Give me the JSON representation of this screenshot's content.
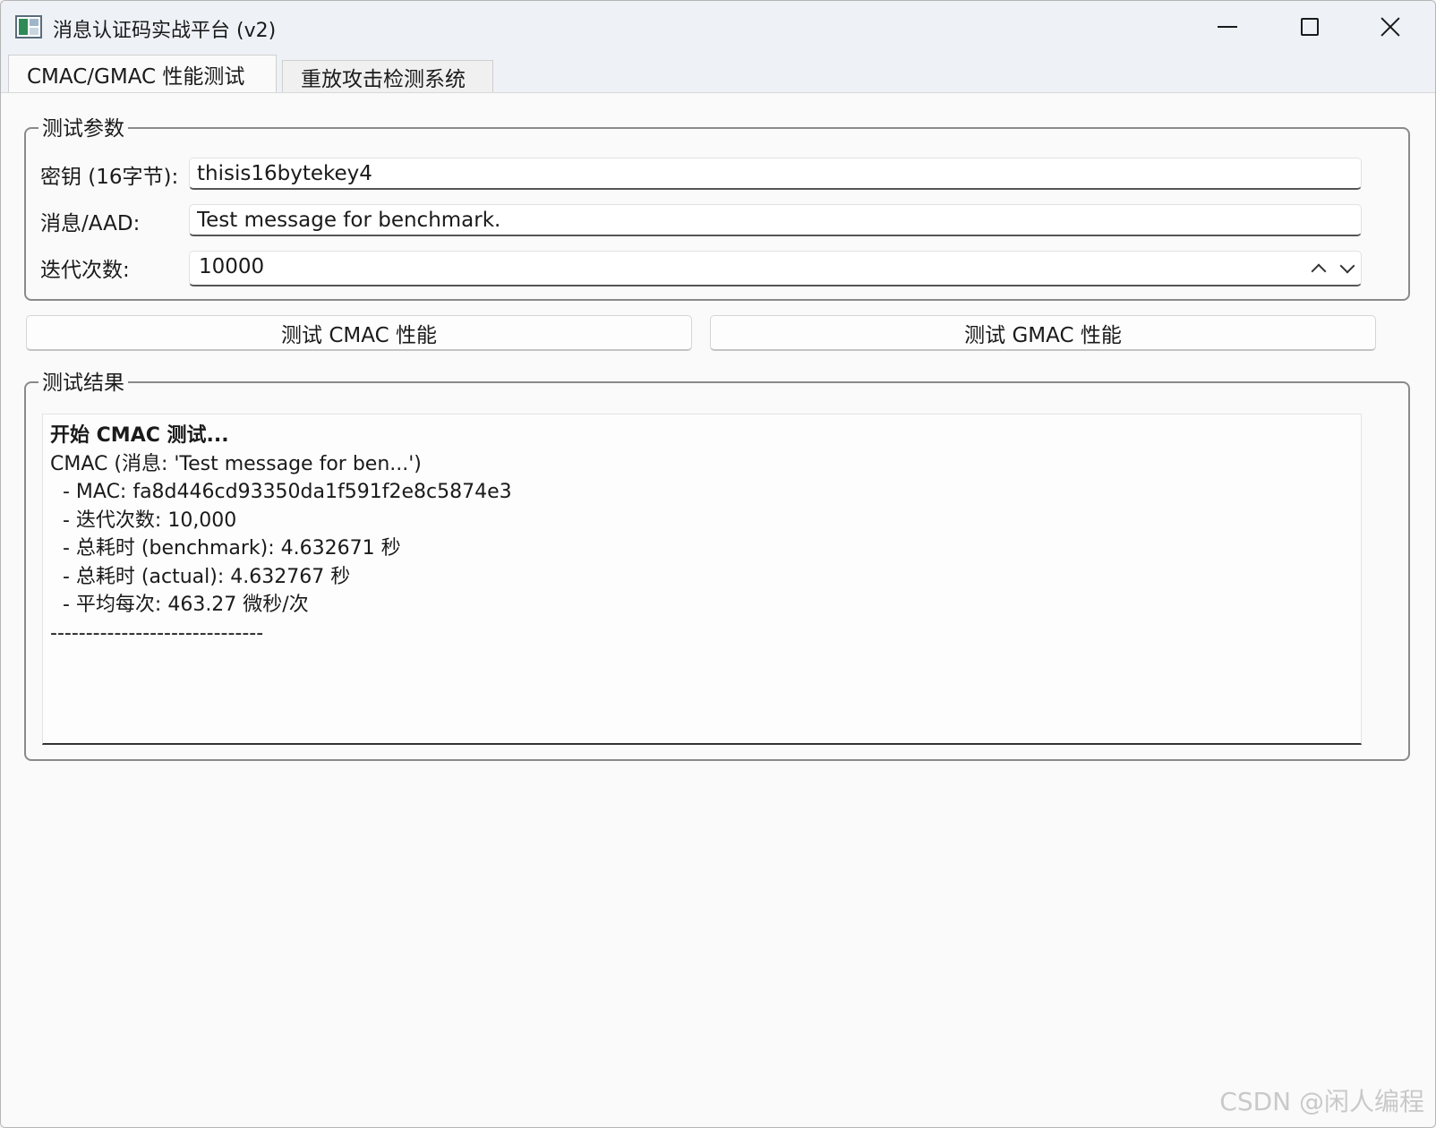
{
  "window": {
    "title": "消息认证码实战平台 (v2)"
  },
  "tabs": [
    {
      "label": "CMAC/GMAC 性能测试",
      "active": true
    },
    {
      "label": "重放攻击检测系统",
      "active": false
    }
  ],
  "params": {
    "title": "测试参数",
    "key_label": "密钥 (16字节):",
    "key_value": "thisis16bytekey4",
    "message_label": "消息/AAD:",
    "message_value": "Test message for benchmark.",
    "iterations_label": "迭代次数:",
    "iterations_value": "10000"
  },
  "actions": {
    "cmac_label": "测试 CMAC 性能",
    "gmac_label": "测试 GMAC 性能"
  },
  "results": {
    "title": "测试结果",
    "lines": [
      "开始 CMAC 测试...",
      "CMAC (消息: 'Test message for ben...')",
      "  - MAC: fa8d446cd93350da1f591f2e8c5874e3",
      "  - 迭代次数: 10,000",
      "  - 总耗时 (benchmark): 4.632671 秒",
      "  - 总耗时 (actual): 4.632767 秒",
      "  - 平均每次: 463.27 微秒/次",
      "------------------------------"
    ]
  },
  "watermark": "CSDN @闲人编程",
  "icons": {
    "app": "app-window-icon",
    "minimize": "minimize-icon",
    "maximize": "maximize-icon",
    "close": "close-icon",
    "spin_up": "chevron-up-icon",
    "spin_down": "chevron-down-icon"
  }
}
